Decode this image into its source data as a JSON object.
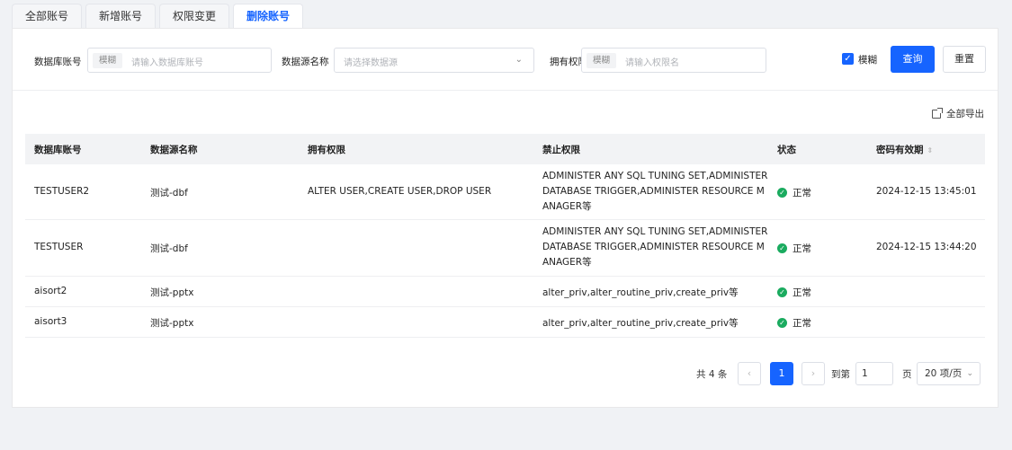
{
  "tabs": [
    {
      "label": "全部账号"
    },
    {
      "label": "新增账号"
    },
    {
      "label": "权限变更"
    },
    {
      "label": "删除账号"
    }
  ],
  "active_tab": 3,
  "filters": {
    "account_label": "数据库账号",
    "account_prefix": "模糊",
    "account_placeholder": "请输入数据库账号",
    "datasource_label": "数据源名称",
    "datasource_placeholder": "请选择数据源",
    "privilege_label": "拥有权限",
    "privilege_prefix": "模糊",
    "privilege_placeholder": "请输入权限名",
    "fuzzy_label": "模糊",
    "fuzzy_checked": true,
    "query_button": "查询",
    "reset_button": "重置"
  },
  "export_label": "全部导出",
  "table": {
    "headers": [
      "数据库账号",
      "数据源名称",
      "拥有权限",
      "禁止权限",
      "状态",
      "密码有效期"
    ],
    "rows": [
      {
        "account": "TESTUSER2",
        "datasource": "测试-dbf",
        "granted": "ALTER USER,CREATE USER,DROP USER",
        "denied": "ADMINISTER ANY SQL TUNING SET,ADMINISTER DATABASE TRIGGER,ADMINISTER RESOURCE MANAGER等",
        "status": "正常",
        "expiry": "2024-12-15 13:45:01"
      },
      {
        "account": "TESTUSER",
        "datasource": "测试-dbf",
        "granted": "",
        "denied": "ADMINISTER ANY SQL TUNING SET,ADMINISTER DATABASE TRIGGER,ADMINISTER RESOURCE MANAGER等",
        "status": "正常",
        "expiry": "2024-12-15 13:44:20"
      },
      {
        "account": "aisort2",
        "datasource": "测试-pptx",
        "granted": "",
        "denied": "alter_priv,alter_routine_priv,create_priv等",
        "status": "正常",
        "expiry": ""
      },
      {
        "account": "aisort3",
        "datasource": "测试-pptx",
        "granted": "",
        "denied": "alter_priv,alter_routine_priv,create_priv等",
        "status": "正常",
        "expiry": ""
      }
    ]
  },
  "pagination": {
    "total": "共 4 条",
    "current_page": "1",
    "goto_label": "到第",
    "goto_value": "1",
    "page_label": "页",
    "page_size": "20 项/页"
  },
  "colors": {
    "accent": "#1664ff",
    "status_ok": "#1aab5f"
  }
}
